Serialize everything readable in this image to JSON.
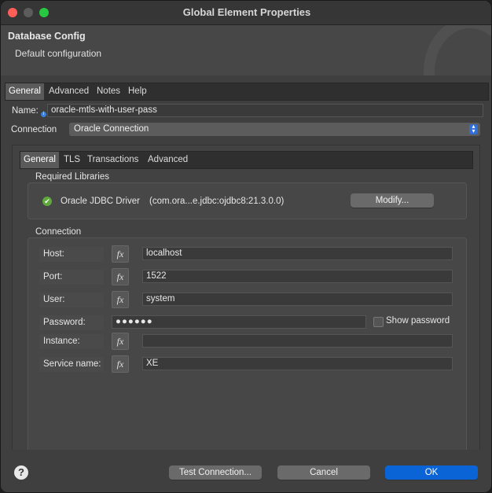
{
  "window": {
    "title": "Global Element Properties"
  },
  "header": {
    "title": "Database Config",
    "subtitle": "Default configuration"
  },
  "outer_tabs": [
    {
      "label": "General",
      "active": true
    },
    {
      "label": "Advanced"
    },
    {
      "label": "Notes"
    },
    {
      "label": "Help"
    }
  ],
  "name_field": {
    "label": "Name:",
    "value": "oracle-mtls-with-user-pass"
  },
  "connection_select": {
    "label": "Connection",
    "value": "Oracle Connection"
  },
  "inner_tabs": [
    {
      "label": "General",
      "active": true
    },
    {
      "label": "TLS"
    },
    {
      "label": "Transactions"
    },
    {
      "label": "Advanced"
    }
  ],
  "required_libraries": {
    "title": "Required Libraries",
    "driver_name": "Oracle JDBC Driver",
    "driver_coord": "(com.ora...e.jdbc:ojdbc8:21.3.0.0)",
    "modify_label": "Modify..."
  },
  "connection_group": {
    "title": "Connection",
    "fx_label": "fx",
    "host": {
      "label": "Host:",
      "value": "localhost"
    },
    "port": {
      "label": "Port:",
      "value": "1522"
    },
    "user": {
      "label": "User:",
      "value": "system"
    },
    "password": {
      "label": "Password:",
      "value": "●●●●●●",
      "show_label": "Show password"
    },
    "instance": {
      "label": "Instance:",
      "value": ""
    },
    "service_name": {
      "label": "Service name:",
      "value": "XE"
    }
  },
  "footer": {
    "help_label": "?",
    "test_label": "Test Connection...",
    "cancel_label": "Cancel",
    "ok_label": "OK"
  }
}
